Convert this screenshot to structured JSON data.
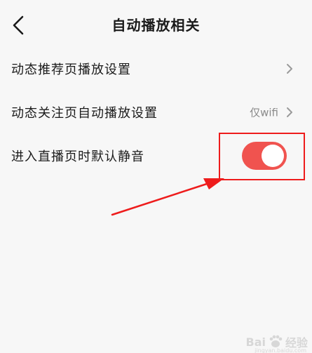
{
  "header": {
    "title": "自动播放相关",
    "back_icon": "chevron-left-icon"
  },
  "settings": {
    "dynamic_recommend": {
      "label": "动态推荐页播放设置",
      "icon": "chevron-right-icon"
    },
    "dynamic_follow": {
      "label": "动态关注页自动播放设置",
      "value": "仅wifi",
      "icon": "chevron-right-icon"
    },
    "live_mute": {
      "label": "进入直播页时默认静音",
      "toggle_on": true,
      "toggle_color": "#f0534f"
    }
  },
  "annotation": {
    "highlight_color": "#ee1c1c"
  },
  "watermark": {
    "brand_text": "Bai",
    "brand_suffix": "经验",
    "url": "jingyan.baidu.com"
  }
}
